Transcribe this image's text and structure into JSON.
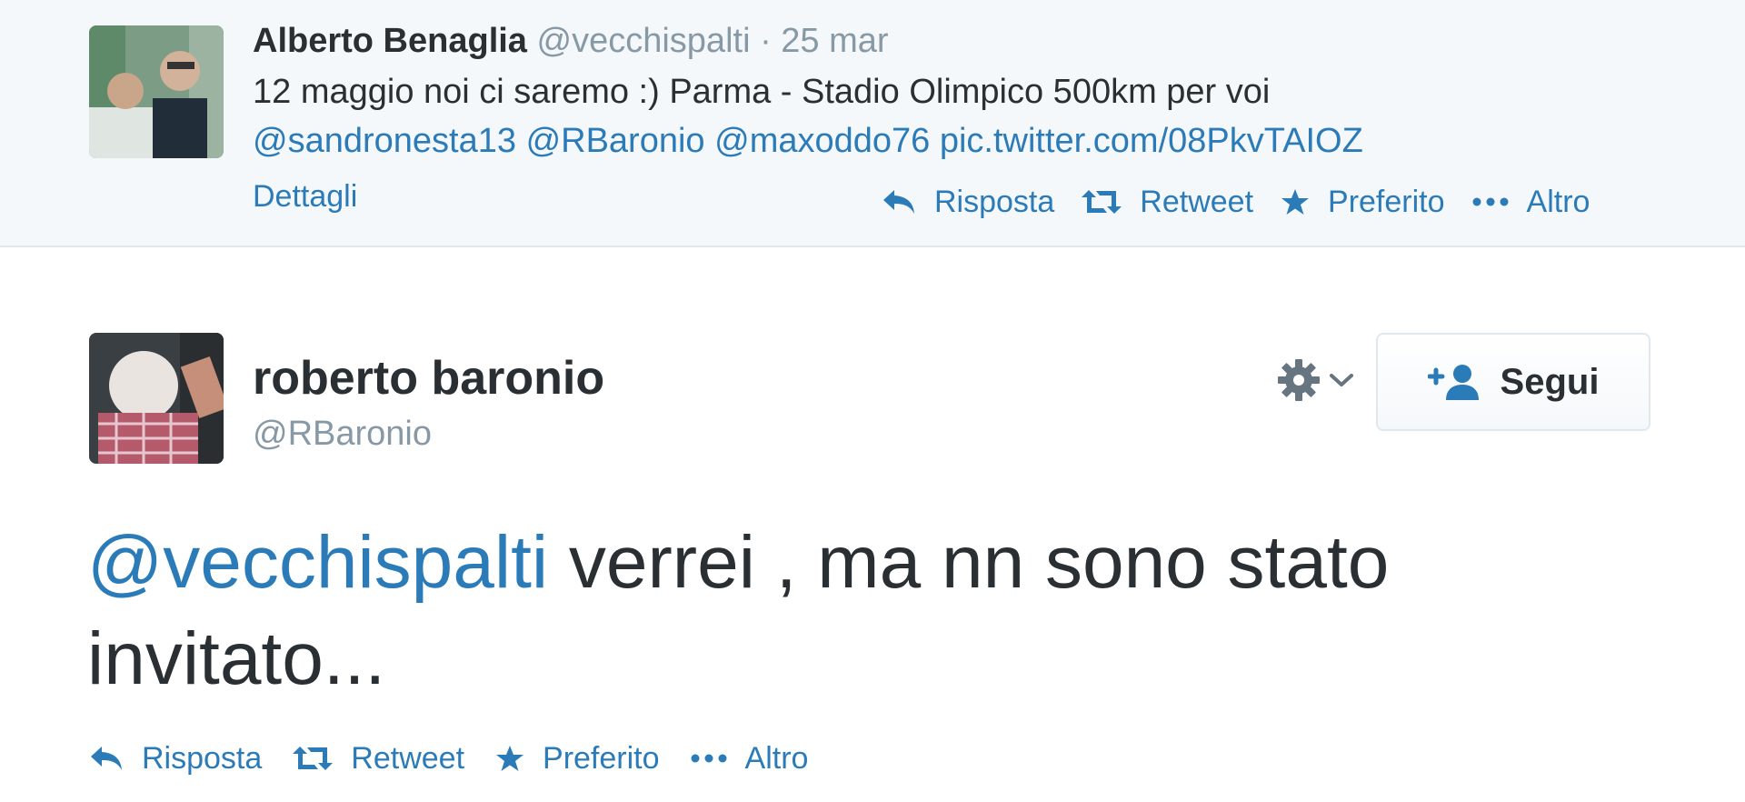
{
  "parent_tweet": {
    "author_name": "Alberto Benaglia",
    "author_handle": "@vecchispalti",
    "separator": "·",
    "date": "25 mar",
    "text": "12 maggio noi ci saremo :) Parma - Stadio Olimpico 500km per voi",
    "mentions": [
      "@sandronesta13",
      "@RBaronio",
      "@maxoddo76"
    ],
    "pic_link": "pic.twitter.com/08PkvTAIOZ",
    "details_label": "Dettagli",
    "actions": {
      "reply": "Risposta",
      "retweet": "Retweet",
      "favorite": "Preferito",
      "more": "Altro"
    }
  },
  "main_tweet": {
    "author_name": "roberto baronio",
    "author_handle": "@RBaronio",
    "mention": "@vecchispalti",
    "text": " verrei , ma nn sono stato invitato...",
    "follow_label": "Segui",
    "actions": {
      "reply": "Risposta",
      "retweet": "Retweet",
      "favorite": "Preferito",
      "more": "Altro"
    }
  },
  "colors": {
    "link": "#2b7bb9",
    "text": "#292f33",
    "muted": "#8899a6",
    "context_bg": "#f5f8fa",
    "border": "#e1e8ed",
    "icon_gray": "#66757f"
  },
  "icons": {
    "reply": "reply-icon",
    "retweet": "retweet-icon",
    "favorite": "star-icon",
    "more": "more-dots-icon",
    "gear": "gear-icon",
    "chevron": "chevron-down-icon",
    "follow": "add-user-icon"
  }
}
